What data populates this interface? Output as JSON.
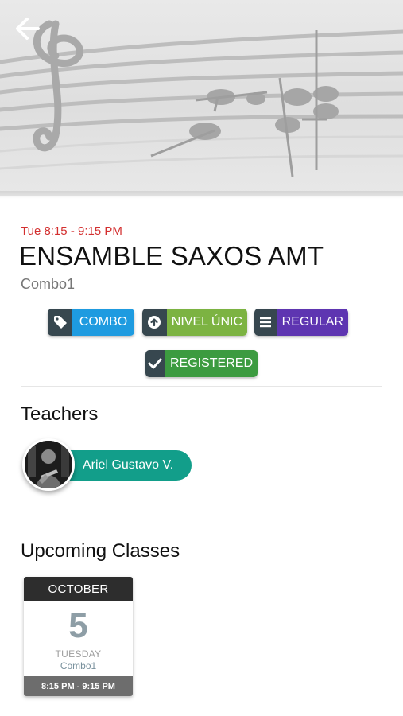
{
  "header": {
    "back_icon": "arrow-left-icon",
    "banner_icon": "music-staff-illustration"
  },
  "course": {
    "schedule": "Tue 8:15 - 9:15 PM",
    "title": "ENSAMBLE SAXOS AMT",
    "subtitle": "Combo1"
  },
  "tags": [
    {
      "label": "COMBO",
      "icon": "tag-icon",
      "color": "#1e9be0"
    },
    {
      "label": "NIVEL ÚNIC",
      "icon": "arrow-up-circle-icon",
      "color": "#7cb342"
    },
    {
      "label": "REGULAR",
      "icon": "list-icon",
      "color": "#5e35b1"
    },
    {
      "label": "REGISTERED",
      "icon": "check-icon",
      "color": "#3c9b40"
    }
  ],
  "teachers": {
    "heading": "Teachers",
    "items": [
      {
        "name": "Ariel Gustavo V.",
        "avatar": "teacher-avatar-photo"
      }
    ]
  },
  "upcoming": {
    "heading": "Upcoming Classes",
    "items": [
      {
        "month": "OCTOBER",
        "day": "5",
        "weekday": "TUESDAY",
        "name": "Combo1",
        "time": "8:15 PM - 9:15 PM"
      }
    ]
  }
}
